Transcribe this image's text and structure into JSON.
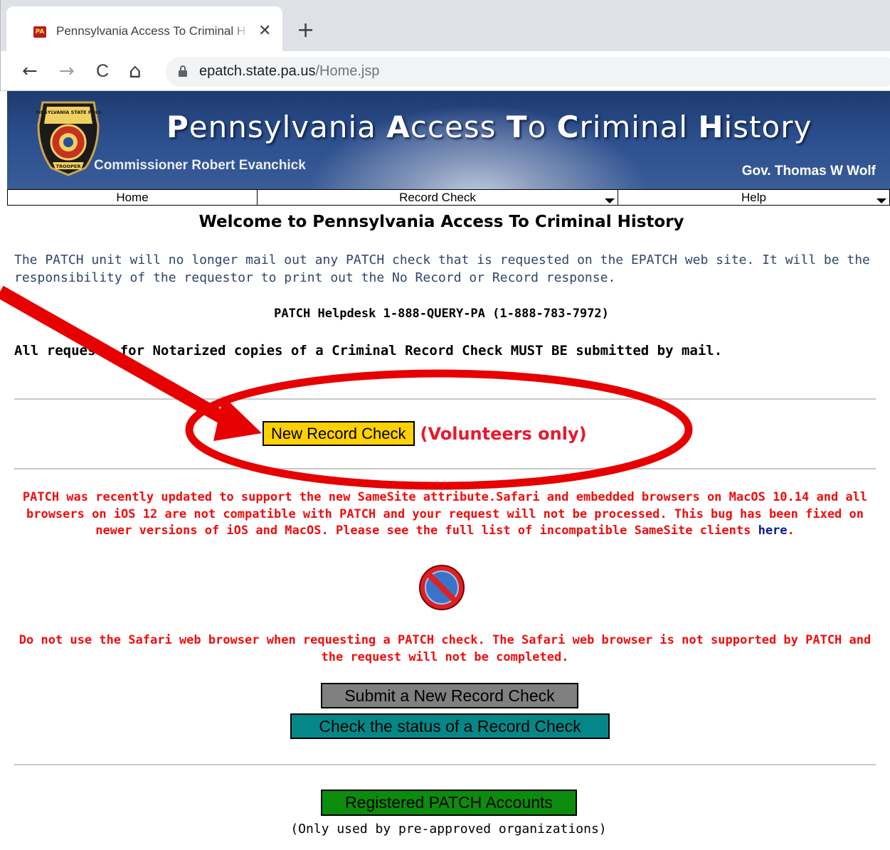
{
  "browser": {
    "tab_title": "Pennsylvania Access To Criminal History",
    "tab_favicon_text": "PA",
    "tab_close_glyph": "✕",
    "new_tab_glyph": "+",
    "back_glyph": "←",
    "forward_glyph": "→",
    "reload_glyph": "C",
    "home_glyph": "⌂",
    "url_domain": "epatch.state.pa.us",
    "url_path": "/Home.jsp",
    "icons": [
      "tab-favicon-icon",
      "close-icon",
      "new-tab-icon",
      "back-arrow-icon",
      "forward-arrow-icon",
      "reload-icon",
      "home-icon",
      "lock-icon"
    ]
  },
  "header": {
    "title_parts": [
      {
        "cap": "P",
        "rest": "ennsylvania "
      },
      {
        "cap": "A",
        "rest": "ccess "
      },
      {
        "cap": "T",
        "rest": "o "
      },
      {
        "cap": "C",
        "rest": "riminal "
      },
      {
        "cap": "H",
        "rest": "istory"
      }
    ],
    "commissioner": "Commissioner Robert Evanchick",
    "governor": "Gov. Thomas W Wolf",
    "badge_top_text": "PENNSYLVANIA STATE POLICE",
    "badge_bottom_text": "TROOPER",
    "colors": {
      "header_dark": "#1e3b70",
      "header_light": "#8698bb"
    }
  },
  "nav": {
    "items": [
      {
        "label": "Home",
        "has_dropdown": false
      },
      {
        "label": "Record Check",
        "has_dropdown": true
      },
      {
        "label": "Help",
        "has_dropdown": true
      }
    ]
  },
  "main": {
    "title": "Welcome to Pennsylvania Access To Criminal History",
    "notice": "The PATCH unit will no longer mail out any PATCH check that is requested on the EPATCH web site. It will be the responsibility of the requestor to print out the No Record or Record response.",
    "helpdesk": "PATCH Helpdesk 1-888-QUERY-PA (1-888-783-7972)",
    "notarized": "All requests for Notarized copies of a Criminal Record Check MUST BE submitted by mail.",
    "new_record_check_label": "New Record Check",
    "volunteers_only": "(Volunteers only)",
    "samesite_text": "PATCH was recently updated to support the new SameSite attribute.Safari and embedded browsers on MacOS 10.14 and all browsers on iOS 12 are not compatible with PATCH and your request will not be processed. This bug has been fixed on newer versions of iOS and MacOS. Please see the full list of incompatible SameSite clients ",
    "samesite_link": "here",
    "samesite_end": ".",
    "safari_warning": "Do not use the Safari web browser when requesting a PATCH check. The Safari web browser is not supported by PATCH and the request will not be completed.",
    "submit_label": "Submit a New Record Check",
    "status_label": "Check the status of a Record Check",
    "registered_label": "Registered PATCH Accounts",
    "registered_note": "(Only used by pre-approved organizations)",
    "colors": {
      "notice_text": "#30456b",
      "warning_red": "#ef0d0d",
      "volunteers_red": "#e8192c",
      "link_blue": "#0d1a8c",
      "new_record_button": "#ffd100",
      "submit_button": "#808080",
      "status_button": "#068787",
      "registered_button": "#0c8c0c"
    }
  },
  "annotation": {
    "color": "#e60000",
    "shapes": [
      "arrow",
      "ellipse"
    ]
  }
}
